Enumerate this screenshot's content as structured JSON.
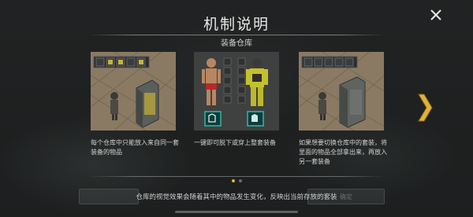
{
  "dialog": {
    "title": "机制说明",
    "subtitle": "装备仓库",
    "close_icon": "close-icon",
    "next_icon": "chevron-right-icon",
    "accent_color": "#e2b23a"
  },
  "cards": [
    {
      "image": "storage-locker-scene",
      "description": "每个仓库中只能放入来自同一套装备的物品"
    },
    {
      "image": "character-outfit-swap",
      "description": "一键即可脱下或穿上整套装备"
    },
    {
      "image": "storage-locker-scene-2",
      "description": "如果想要切换仓库中的套装，将里面的物品全部拿出来，再放入另一套装备"
    }
  ],
  "pagination": {
    "current": 1,
    "total": 2
  },
  "footer": {
    "note": "仓库的视觉效果会随着其中的物品发生变化，反映出当前存放的套装",
    "confirm_label": "确定"
  }
}
